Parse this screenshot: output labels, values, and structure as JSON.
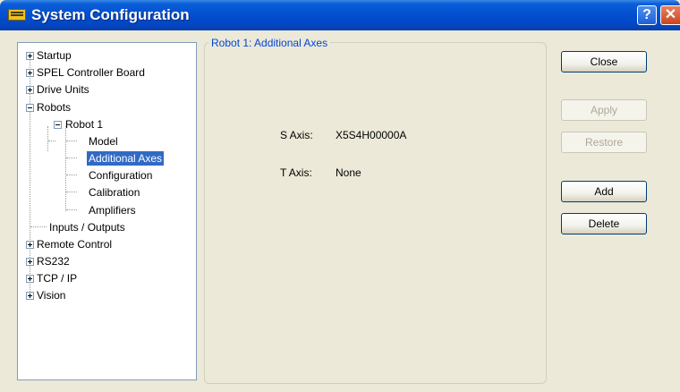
{
  "window": {
    "title": "System Configuration",
    "help_glyph": "?",
    "close_glyph": "✕"
  },
  "tree": {
    "items": [
      {
        "label": "Startup",
        "expander": "plus"
      },
      {
        "label": "SPEL Controller Board",
        "expander": "plus"
      },
      {
        "label": "Drive Units",
        "expander": "plus"
      },
      {
        "label": "Robots",
        "expander": "minus"
      },
      {
        "label": "Robot 1",
        "expander": "minus"
      },
      {
        "label": "Model"
      },
      {
        "label": "Additional Axes",
        "selected": true
      },
      {
        "label": "Configuration"
      },
      {
        "label": "Calibration"
      },
      {
        "label": "Amplifiers"
      },
      {
        "label": "Inputs / Outputs"
      },
      {
        "label": "Remote Control",
        "expander": "plus"
      },
      {
        "label": "RS232",
        "expander": "plus"
      },
      {
        "label": "TCP / IP",
        "expander": "plus"
      },
      {
        "label": "Vision",
        "expander": "plus"
      }
    ]
  },
  "panel": {
    "title": "Robot 1: Additional Axes",
    "s_axis": {
      "label": "S Axis:",
      "value": "X5S4H00000A"
    },
    "t_axis": {
      "label": "T Axis:",
      "value": "None"
    }
  },
  "buttons": {
    "close": {
      "label": "Close",
      "enabled": true
    },
    "apply": {
      "label": "Apply",
      "enabled": false
    },
    "restore": {
      "label": "Restore",
      "enabled": false
    },
    "add": {
      "label": "Add",
      "enabled": true
    },
    "delete": {
      "label": "Delete",
      "enabled": true
    }
  }
}
